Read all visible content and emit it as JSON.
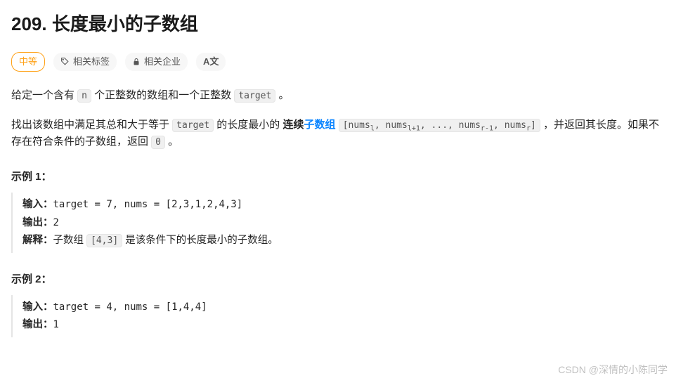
{
  "title": "209. 长度最小的子数组",
  "tags": {
    "difficulty": "中等",
    "labels": "相关标签",
    "companies": "相关企业",
    "translate": "A文"
  },
  "desc1": {
    "pre": "给定一个含有 ",
    "code1": "n",
    "mid": " 个正整数的数组和一个正整数 ",
    "code2": "target",
    "post": " 。"
  },
  "desc2": {
    "pre": "找出该数组中满足其总和大于等于 ",
    "code1": "target",
    "mid": " 的长度最小的 ",
    "bold_pre": "连续",
    "link": "子数组",
    "code2_html": "[numsₗ, numsₗ₊₁, ..., numsᵣ₋₁, numsᵣ]",
    "post1": " ，并返回其长度。如果不存在符合条件的子数组，返回 ",
    "code3": "0",
    "post2": " 。"
  },
  "ex1": {
    "title": "示例 1：",
    "input_lbl": "输入：",
    "input_val": "target = 7, nums = [2,3,1,2,4,3]",
    "output_lbl": "输出：",
    "output_val": "2",
    "explain_lbl": "解释：",
    "explain_pre": "子数组 ",
    "explain_code": "[4,3]",
    "explain_post": " 是该条件下的长度最小的子数组。"
  },
  "ex2": {
    "title": "示例 2：",
    "input_lbl": "输入：",
    "input_val": "target = 4, nums = [1,4,4]",
    "output_lbl": "输出：",
    "output_val": "1"
  },
  "watermark": "CSDN @深情的小陈同学"
}
